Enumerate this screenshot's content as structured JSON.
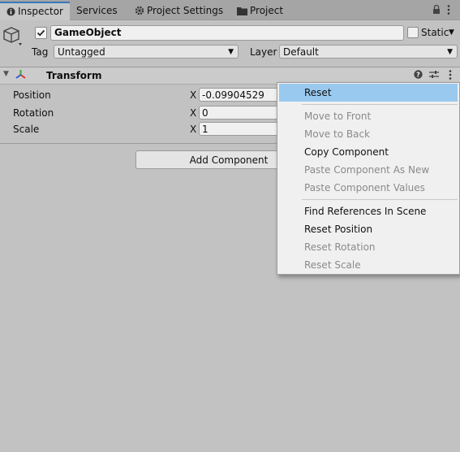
{
  "tabs": [
    {
      "label": "Inspector",
      "icon": "info-icon"
    },
    {
      "label": "Services"
    },
    {
      "label": "Project Settings",
      "icon": "gear-icon"
    },
    {
      "label": "Project",
      "icon": "folder-icon"
    }
  ],
  "header": {
    "name": "GameObject",
    "static_label": "Static",
    "tag_label": "Tag",
    "tag_value": "Untagged",
    "layer_label": "Layer",
    "layer_value": "Default"
  },
  "component": {
    "title": "Transform",
    "fields": [
      {
        "label": "Position",
        "axis": "X",
        "value": "-0.09904529"
      },
      {
        "label": "Rotation",
        "axis": "X",
        "value": "0"
      },
      {
        "label": "Scale",
        "axis": "X",
        "value": "1"
      }
    ]
  },
  "add_component_label": "Add Component",
  "context_menu": {
    "items": [
      {
        "label": "Reset",
        "state": "highlighted"
      },
      {
        "label": "Move to Front",
        "state": "disabled"
      },
      {
        "label": "Move to Back",
        "state": "disabled"
      },
      {
        "label": "Copy Component",
        "state": "enabled"
      },
      {
        "label": "Paste Component As New",
        "state": "disabled"
      },
      {
        "label": "Paste Component Values",
        "state": "disabled"
      },
      {
        "label": "Find References In Scene",
        "state": "enabled"
      },
      {
        "label": "Reset Position",
        "state": "enabled"
      },
      {
        "label": "Reset Rotation",
        "state": "disabled"
      },
      {
        "label": "Reset Scale",
        "state": "disabled"
      }
    ]
  },
  "colors": {
    "highlight": "#99c9ef",
    "tab_accent": "#3a79bb",
    "panel_bg": "#c2c2c2",
    "axis_red": "#d9342b",
    "axis_green": "#3aa63a",
    "axis_blue": "#2f5fd0"
  }
}
